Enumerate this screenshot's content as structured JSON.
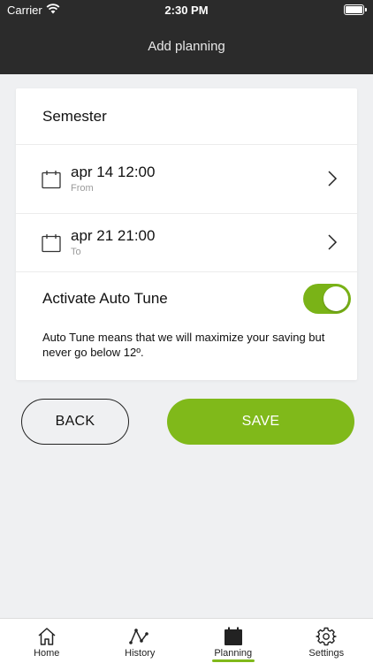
{
  "status_bar": {
    "carrier": "Carrier",
    "time": "2:30 PM"
  },
  "header": {
    "title": "Add planning"
  },
  "form": {
    "name_value": "Semester",
    "from": {
      "date": "apr 14 12:00",
      "label": "From"
    },
    "to": {
      "date": "apr 21 21:00",
      "label": "To"
    },
    "autotune": {
      "label": "Activate Auto Tune",
      "enabled": true,
      "description": "Auto Tune means that we will maximize your saving but never go below 12º."
    }
  },
  "actions": {
    "back_label": "BACK",
    "save_label": "SAVE"
  },
  "tabs": [
    {
      "label": "Home",
      "icon": "home-icon"
    },
    {
      "label": "History",
      "icon": "history-icon"
    },
    {
      "label": "Planning",
      "icon": "calendar-icon",
      "active": true
    },
    {
      "label": "Settings",
      "icon": "gear-icon"
    }
  ],
  "colors": {
    "accent": "#80b91a",
    "header_bg": "#2b2b2b",
    "background": "#eff0f2"
  }
}
